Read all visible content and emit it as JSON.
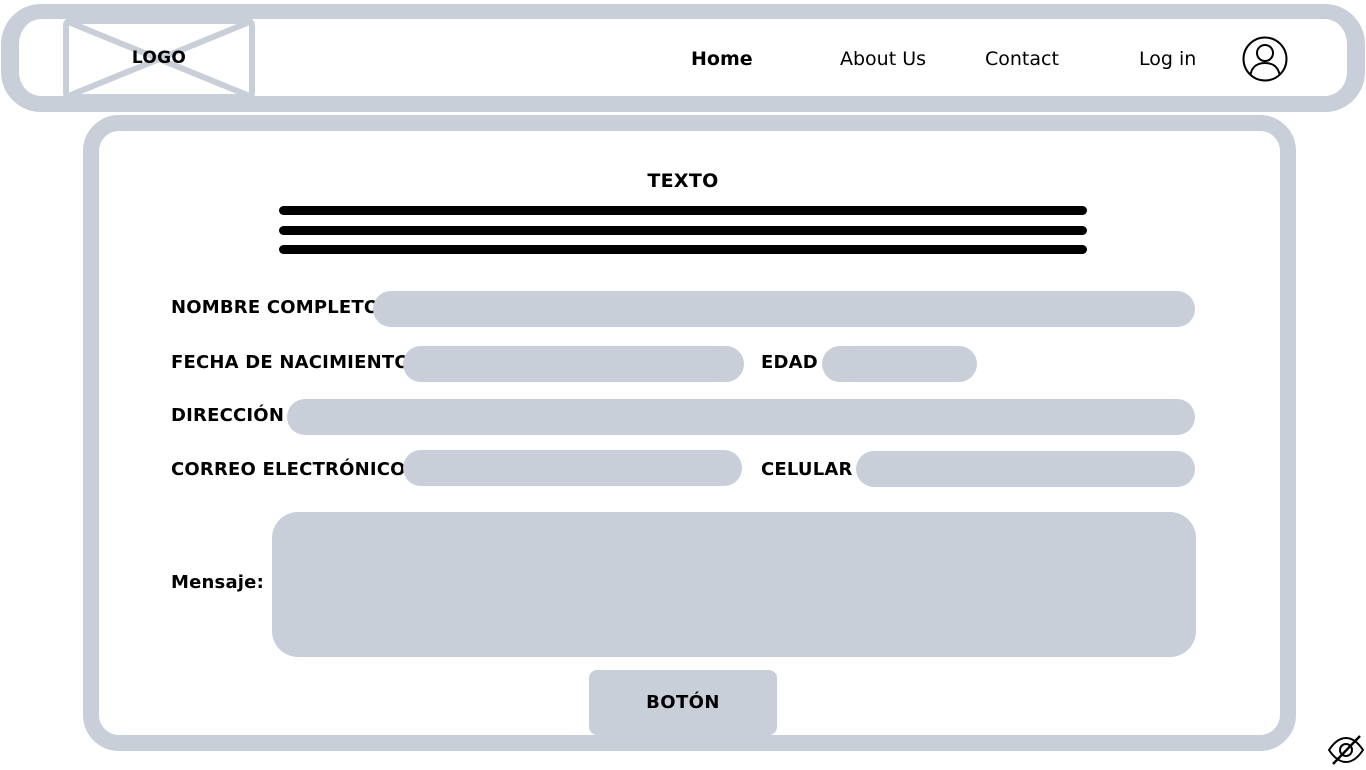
{
  "header": {
    "logo_label": "LOGO",
    "nav": {
      "home": "Home",
      "about": "About Us",
      "contact": "Contact",
      "login": "Log in"
    },
    "avatar_icon": "user-circle-icon"
  },
  "main": {
    "title": "TEXTO",
    "form": {
      "full_name_label": "NOMBRE COMPLETO",
      "birth_date_label": "FECHA DE NACIMIENTO",
      "age_label": "EDAD",
      "address_label": "DIRECCIÓN",
      "email_label": "CORREO ELECTRÓNICO",
      "phone_label": "CELULAR",
      "message_label": "Mensaje:",
      "submit_label": "BOTÓN"
    }
  },
  "icons": {
    "corner_icon": "eye-slash-icon"
  },
  "colors": {
    "wireframe_gray": "#c8cfd9",
    "text": "#000000",
    "background": "#ffffff"
  }
}
